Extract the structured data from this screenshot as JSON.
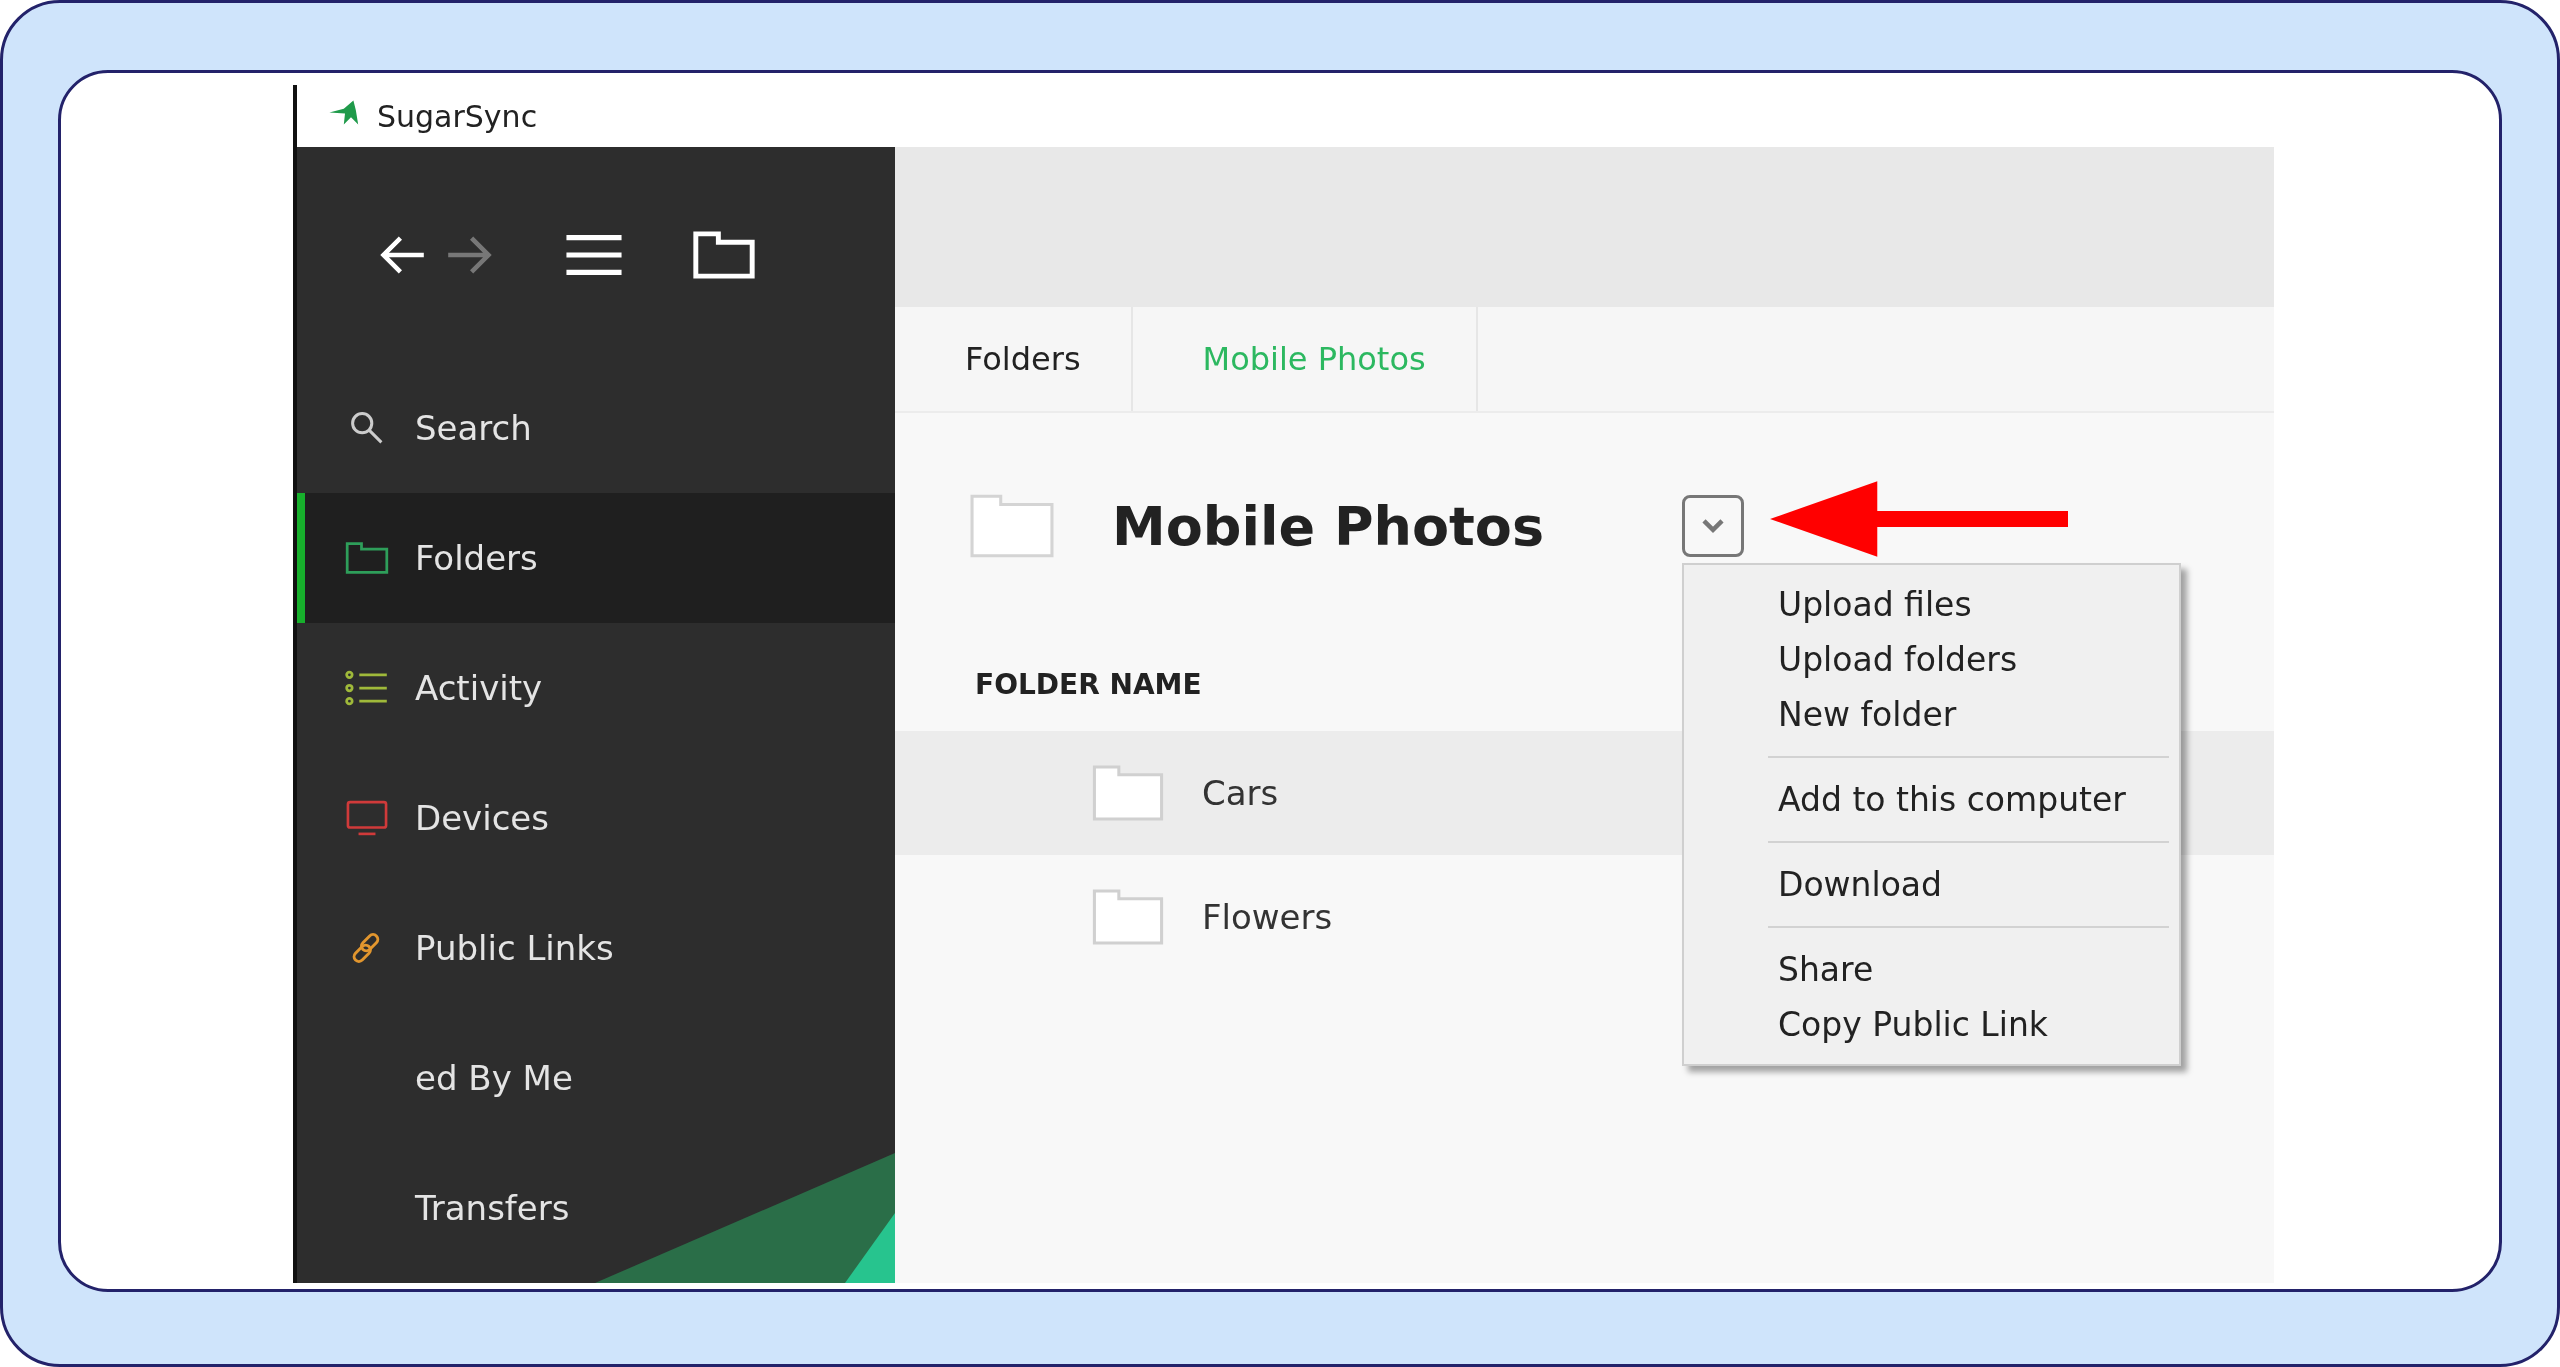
{
  "window": {
    "title": "SugarSync"
  },
  "toolbar": {
    "back_enabled": true,
    "forward_enabled": false
  },
  "sidebar": {
    "items": [
      {
        "label": "Search",
        "kind": "search",
        "selected": false
      },
      {
        "label": "Folders",
        "kind": "folders",
        "selected": true
      },
      {
        "label": "Activity",
        "kind": "activity",
        "selected": false
      },
      {
        "label": "Devices",
        "kind": "devices",
        "selected": false
      },
      {
        "label": "Public Links",
        "kind": "links",
        "selected": false
      },
      {
        "label": "ed By Me",
        "kind": "plain",
        "selected": false
      },
      {
        "label": "Transfers",
        "kind": "plain",
        "selected": false
      }
    ]
  },
  "breadcrumb": [
    {
      "label": "Folders",
      "selected": false
    },
    {
      "label": "Mobile Photos",
      "selected": true
    }
  ],
  "folder": {
    "title": "Mobile Photos"
  },
  "table": {
    "column": "FOLDER NAME",
    "rows": [
      {
        "name": "Cars",
        "selected": true
      },
      {
        "name": "Flowers",
        "selected": false
      }
    ]
  },
  "menu": {
    "groups": [
      [
        "Upload files",
        "Upload folders",
        "New folder"
      ],
      [
        "Add to this computer"
      ],
      [
        "Download"
      ],
      [
        "Share",
        "Copy Public Link"
      ]
    ]
  }
}
